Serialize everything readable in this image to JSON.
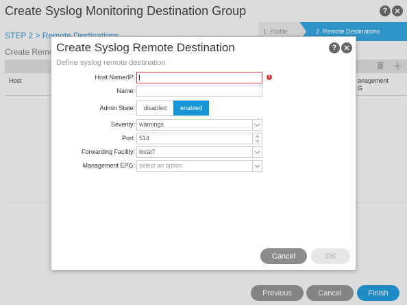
{
  "background": {
    "title": "Create Syslog Monitoring Destination Group",
    "step_heading": "STEP 2 > Remote Destinations",
    "create_label": "Create Remo",
    "steps": [
      {
        "label": "1. Profile",
        "active": false
      },
      {
        "label": "2. Remote Destinations",
        "active": true
      }
    ],
    "table": {
      "columns": [
        "Host",
        "Management EPG"
      ],
      "mgmt_visible_line1": "anagement",
      "mgmt_visible_line2": "G"
    },
    "footer": {
      "previous_label": "Previous",
      "cancel_label": "Cancel",
      "finish_label": "Finish"
    }
  },
  "modal": {
    "title": "Create Syslog Remote Destination",
    "subtitle": "Define syslog remote destination",
    "fields": {
      "host": {
        "label": "Host Name/IP:",
        "value": "",
        "error": true
      },
      "name": {
        "label": "Name:",
        "value": ""
      },
      "admin_state": {
        "label": "Admin State:",
        "options": [
          "disabled",
          "enabled"
        ],
        "selected": "enabled"
      },
      "severity": {
        "label": "Severity:",
        "value": "warnings"
      },
      "port": {
        "label": "Port:",
        "value": "514"
      },
      "forwarding_facility": {
        "label": "Forwarding Facility:",
        "value": "local7"
      },
      "management_epg": {
        "label": "Management EPG:",
        "placeholder": "select an option"
      }
    },
    "buttons": {
      "cancel_label": "Cancel",
      "ok_label": "OK"
    }
  },
  "colors": {
    "accent": "#2ca0db",
    "toggle_on": "#1895d6",
    "error": "#c83c3c",
    "button_dark": "#8c8c8c"
  },
  "icons": {
    "help": "help-icon",
    "close": "close-icon",
    "trash": "trash-icon",
    "add": "add-icon",
    "error": "error-icon",
    "dropdown": "chevron-down-icon",
    "spinner": "spinner-icon"
  }
}
